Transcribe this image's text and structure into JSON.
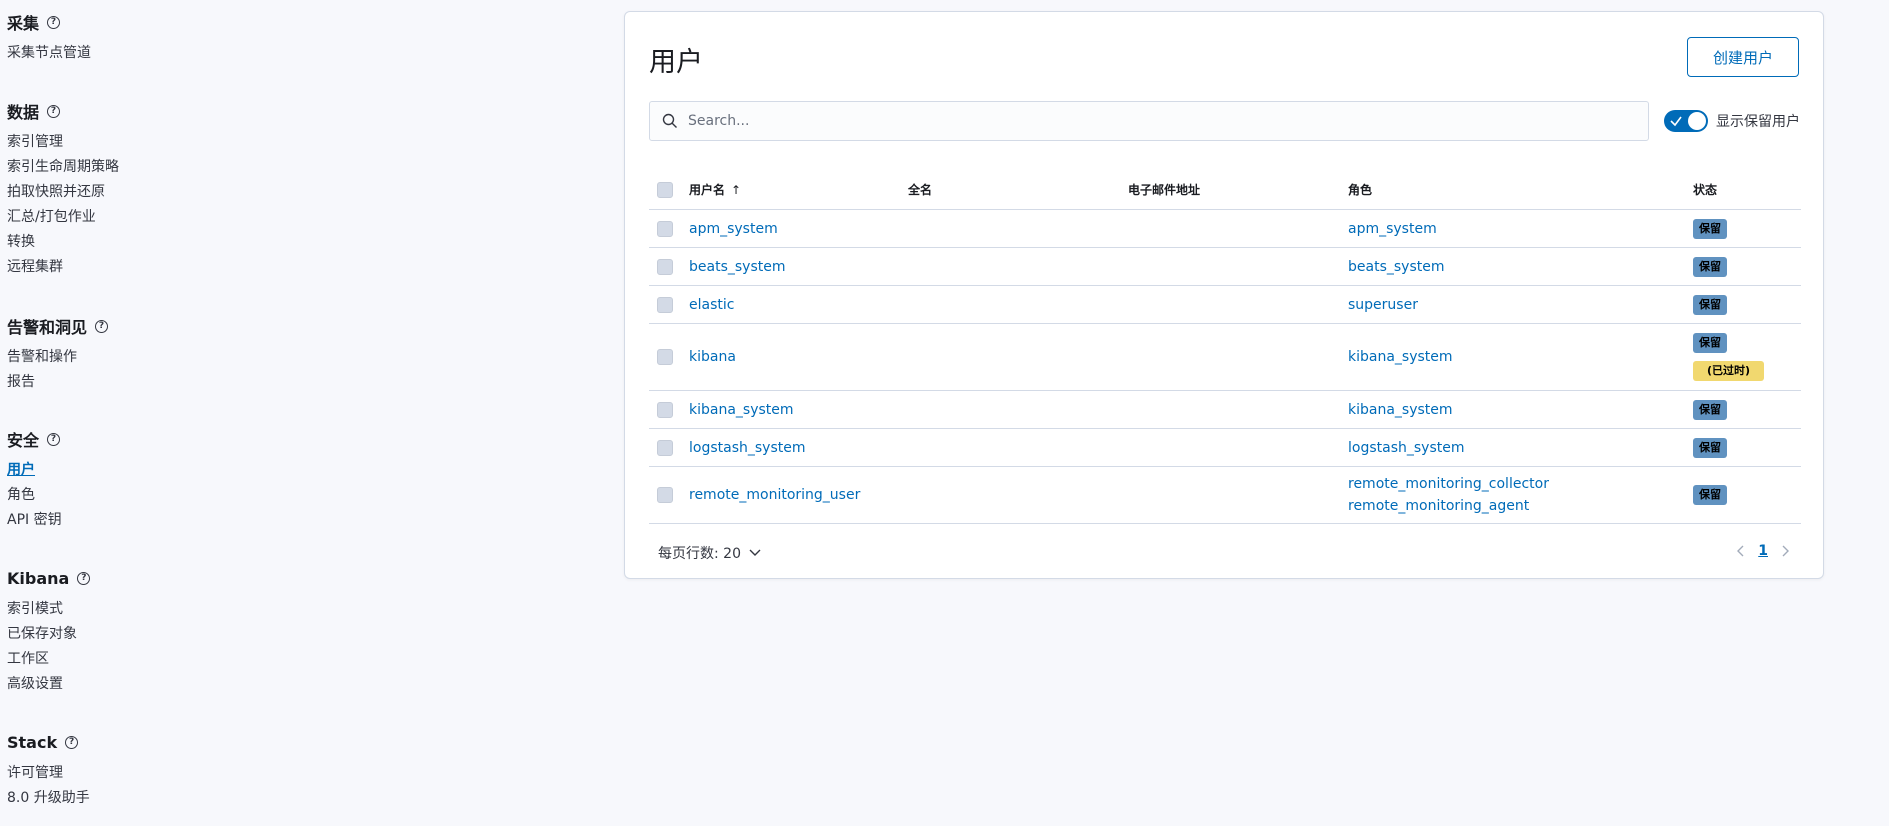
{
  "sidebar": {
    "sections": [
      {
        "title": "采集",
        "items": [
          "采集节点管道"
        ]
      },
      {
        "title": "数据",
        "items": [
          "索引管理",
          "索引生命周期策略",
          "拍取快照并还原",
          "汇总/打包作业",
          "转换",
          "远程集群"
        ]
      },
      {
        "title": "告警和洞见",
        "items": [
          "告警和操作",
          "报告"
        ]
      },
      {
        "title": "安全",
        "items": [
          "用户",
          "角色",
          "API 密钥"
        ],
        "active": "用户"
      },
      {
        "title": "Kibana",
        "items": [
          "索引模式",
          "已保存对象",
          "工作区",
          "高级设置"
        ]
      },
      {
        "title": "Stack",
        "items": [
          "许可管理",
          "8.0 升级助手"
        ]
      }
    ],
    "help_glyph": "?"
  },
  "main": {
    "title": "用户",
    "create_button": "创建用户",
    "search_placeholder": "Search...",
    "toggle_label": "显示保留用户",
    "toggle_on": true,
    "columns": {
      "username": "用户名",
      "fullname": "全名",
      "email": "电子邮件地址",
      "roles": "角色",
      "status": "状态"
    },
    "sort_glyph": "↑",
    "rows": [
      {
        "username": "apm_system",
        "roles": [
          "apm_system"
        ],
        "badges": [
          "保留"
        ]
      },
      {
        "username": "beats_system",
        "roles": [
          "beats_system"
        ],
        "badges": [
          "保留"
        ]
      },
      {
        "username": "elastic",
        "roles": [
          "superuser"
        ],
        "badges": [
          "保留"
        ]
      },
      {
        "username": "kibana",
        "roles": [
          "kibana_system"
        ],
        "badges": [
          "保留",
          "(已过时)"
        ]
      },
      {
        "username": "kibana_system",
        "roles": [
          "kibana_system"
        ],
        "badges": [
          "保留"
        ]
      },
      {
        "username": "logstash_system",
        "roles": [
          "logstash_system"
        ],
        "badges": [
          "保留"
        ]
      },
      {
        "username": "remote_monitoring_user",
        "roles": [
          "remote_monitoring_collector",
          "remote_monitoring_agent"
        ],
        "badges": [
          "保留"
        ]
      }
    ],
    "rows_per_page": "每页行数: 20",
    "current_page": "1"
  },
  "colors": {
    "accent": "#006bb8",
    "reserved_badge": "#6092c0",
    "deprecated_badge": "#f1d86f"
  },
  "icons": [
    "help-icon",
    "search-icon",
    "check-icon",
    "sort-up-icon",
    "chevron-down-icon",
    "chevron-left-icon",
    "chevron-right-icon"
  ]
}
